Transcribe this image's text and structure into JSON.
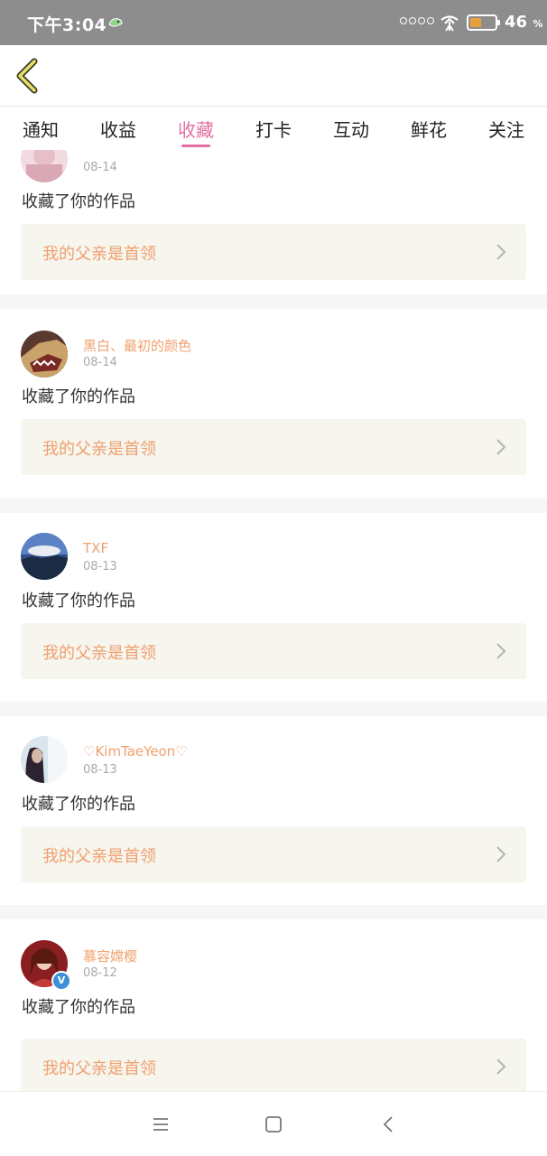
{
  "status_bar": {
    "time": "下午3:04",
    "battery_percent": "46",
    "battery_symbol": "%",
    "battery_level": 0.46,
    "battery_color": "#e8a13a",
    "app_icon": "bird-icon",
    "signal_icon": "signal-dots-icon",
    "wifi_icon": "wifi-icon"
  },
  "header": {
    "back_icon": "chevron-left-icon"
  },
  "tabs": [
    {
      "label": "通知"
    },
    {
      "label": "收益"
    },
    {
      "label": "收藏",
      "active": true
    },
    {
      "label": "打卡"
    },
    {
      "label": "互动"
    },
    {
      "label": "鲜花"
    },
    {
      "label": "关注"
    }
  ],
  "theme": {
    "accent": "#e36fa3",
    "username_color": "#f0a06e",
    "card_bg": "#f6f5ee"
  },
  "notifications": [
    {
      "username": "",
      "date": "08-14",
      "action": "收藏了你的作品",
      "work_title": "我的父亲是首领"
    },
    {
      "username": "黑白、最初的颜色",
      "date": "08-14",
      "action": "收藏了你的作品",
      "work_title": "我的父亲是首领"
    },
    {
      "username": "TXF",
      "date": "08-13",
      "action": "收藏了你的作品",
      "work_title": "我的父亲是首领"
    },
    {
      "username": "♡KimTaeYeon♡",
      "date": "08-13",
      "action": "收藏了你的作品",
      "work_title": "我的父亲是首领"
    },
    {
      "username": "慕容嫦樱",
      "date": "08-12",
      "action": "收藏了你的作品",
      "work_title": "我的父亲是首领",
      "verified": true,
      "verified_label": "V"
    }
  ],
  "nav_bar": {
    "menu_icon": "menu-icon",
    "home_icon": "square-home-icon",
    "back_icon": "back-triangle-icon"
  }
}
